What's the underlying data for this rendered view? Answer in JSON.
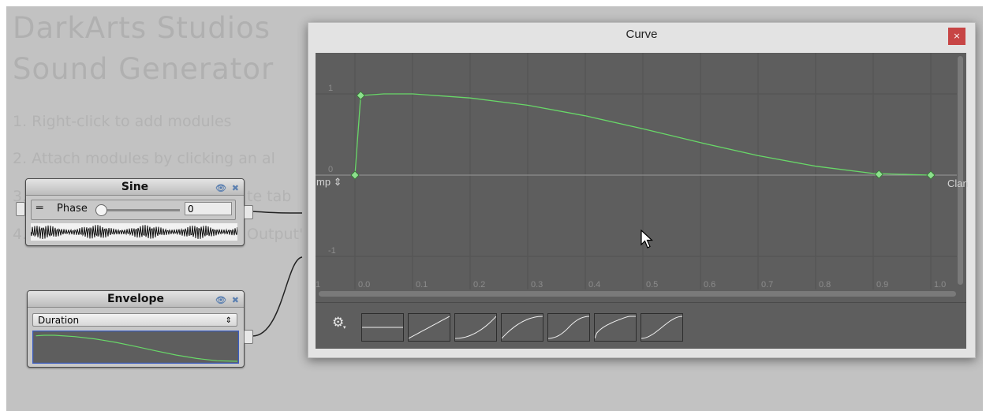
{
  "background": {
    "title_line1": "DarkArts Studios",
    "title_line2": "Sound Generator",
    "steps": [
      "1. Right-click to add modules",
      "2. Attach modules by clicking an al",
      "3.",
      "te tab",
      "4.",
      "Output'"
    ]
  },
  "sine_node": {
    "title": "Sine",
    "phase_label": "Phase",
    "phase_value": "0"
  },
  "envelope_node": {
    "title": "Envelope",
    "duration_label": "Duration"
  },
  "curve_window": {
    "title": "Curve",
    "close_glyph": "×",
    "left_wrap": "mp ⇕",
    "right_wrap": "Clan",
    "x_ticks": [
      "1",
      "0.0",
      "0.1",
      "0.2",
      "0.3",
      "0.4",
      "0.5",
      "0.6",
      "0.7",
      "0.8",
      "0.9",
      "1.0"
    ],
    "y_ticks": [
      "1",
      "0",
      "-1"
    ],
    "gear_glyph": "⚙",
    "presets": [
      "constant",
      "linear",
      "ease-in",
      "ease-out",
      "ease-in-out-s",
      "steps",
      "ease-in-out"
    ]
  },
  "colors": {
    "curve": "#68d868",
    "plot_bg": "#5e5e5e",
    "close": "#c74545"
  },
  "chart_data": {
    "type": "line",
    "xlim": [
      -0.07,
      1.05
    ],
    "ylim": [
      -1,
      1
    ],
    "x": [
      0.0,
      0.01,
      0.05,
      0.1,
      0.2,
      0.3,
      0.4,
      0.5,
      0.6,
      0.7,
      0.8,
      0.9,
      1.0
    ],
    "y": [
      0.0,
      0.98,
      1.0,
      1.0,
      0.95,
      0.86,
      0.73,
      0.57,
      0.4,
      0.24,
      0.11,
      0.02,
      0.0
    ],
    "keyframes": [
      [
        0.0,
        0.0
      ],
      [
        0.01,
        0.98
      ],
      [
        0.91,
        0.01
      ],
      [
        1.0,
        0.0
      ]
    ]
  }
}
